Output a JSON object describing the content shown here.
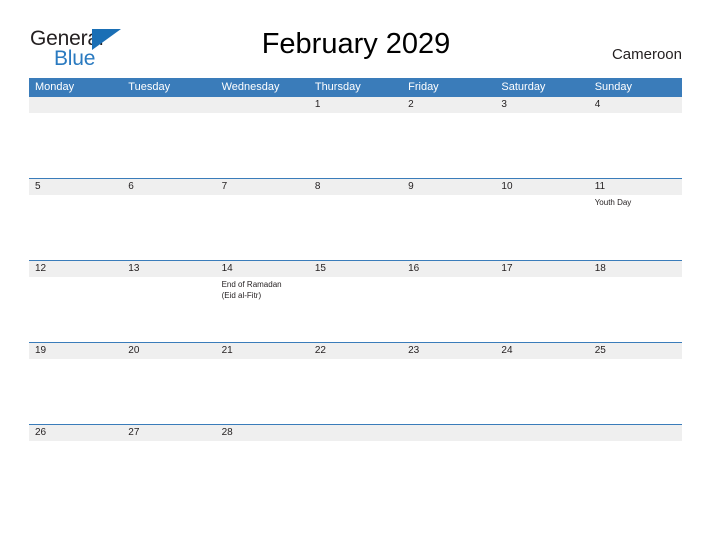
{
  "logo": {
    "word_one": "General",
    "word_two": "Blue",
    "flag_icon": "blue-triangle-flag-icon",
    "color_text": "#231f20",
    "color_blue": "#2a7ac0"
  },
  "header": {
    "title": "February 2029",
    "country": "Cameroon"
  },
  "calendar": {
    "accent_color": "#3a7cba",
    "strip_color": "#efefef",
    "day_names": [
      "Monday",
      "Tuesday",
      "Wednesday",
      "Thursday",
      "Friday",
      "Saturday",
      "Sunday"
    ],
    "weeks": [
      [
        {
          "num": "",
          "events": []
        },
        {
          "num": "",
          "events": []
        },
        {
          "num": "",
          "events": []
        },
        {
          "num": "1",
          "events": []
        },
        {
          "num": "2",
          "events": []
        },
        {
          "num": "3",
          "events": []
        },
        {
          "num": "4",
          "events": []
        }
      ],
      [
        {
          "num": "5",
          "events": []
        },
        {
          "num": "6",
          "events": []
        },
        {
          "num": "7",
          "events": []
        },
        {
          "num": "8",
          "events": []
        },
        {
          "num": "9",
          "events": []
        },
        {
          "num": "10",
          "events": []
        },
        {
          "num": "11",
          "events": [
            "Youth Day"
          ]
        }
      ],
      [
        {
          "num": "12",
          "events": []
        },
        {
          "num": "13",
          "events": []
        },
        {
          "num": "14",
          "events": [
            "End of Ramadan",
            "(Eid al-Fitr)"
          ]
        },
        {
          "num": "15",
          "events": []
        },
        {
          "num": "16",
          "events": []
        },
        {
          "num": "17",
          "events": []
        },
        {
          "num": "18",
          "events": []
        }
      ],
      [
        {
          "num": "19",
          "events": []
        },
        {
          "num": "20",
          "events": []
        },
        {
          "num": "21",
          "events": []
        },
        {
          "num": "22",
          "events": []
        },
        {
          "num": "23",
          "events": []
        },
        {
          "num": "24",
          "events": []
        },
        {
          "num": "25",
          "events": []
        }
      ],
      [
        {
          "num": "26",
          "events": []
        },
        {
          "num": "27",
          "events": []
        },
        {
          "num": "28",
          "events": []
        },
        {
          "num": "",
          "events": []
        },
        {
          "num": "",
          "events": []
        },
        {
          "num": "",
          "events": []
        },
        {
          "num": "",
          "events": []
        }
      ]
    ]
  }
}
